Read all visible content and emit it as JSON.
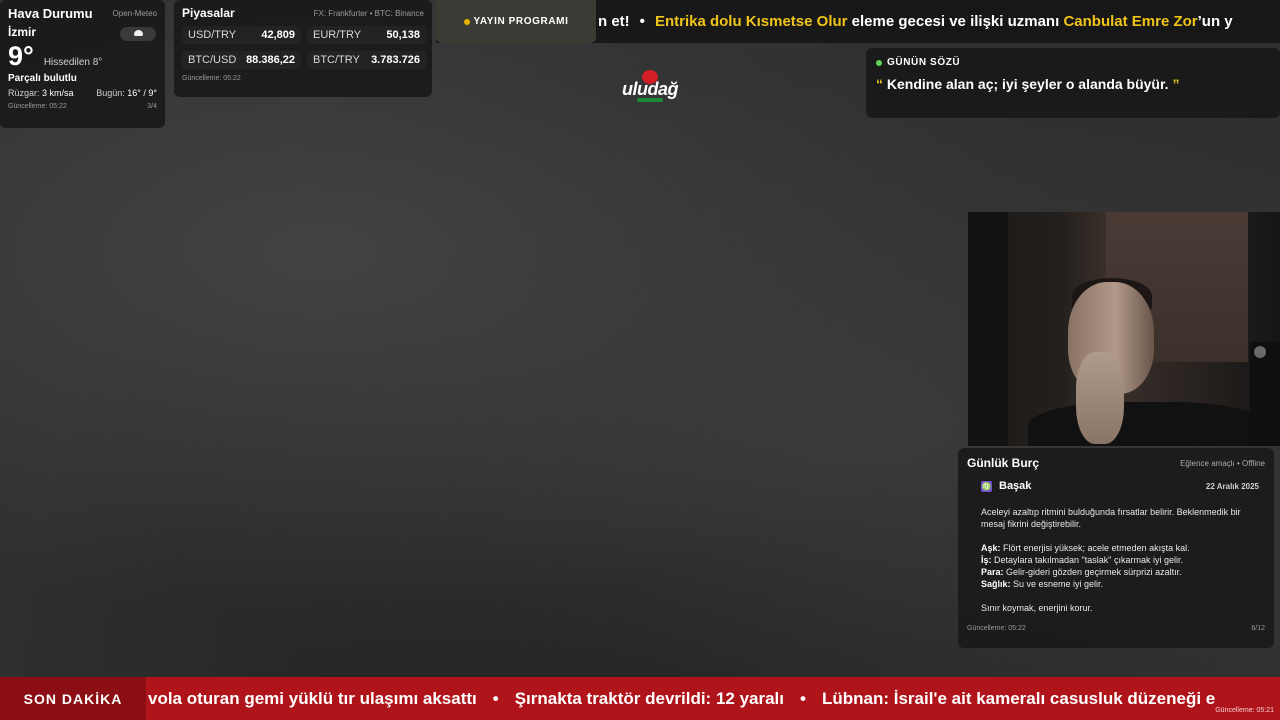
{
  "weather": {
    "title": "Hava Durumu",
    "source": "Open-Meteo",
    "city": "İzmir",
    "temperature": "9°",
    "feels_like": "Hissedilen 8°",
    "condition": "Parçalı bulutlu",
    "wind_label": "Rüzgar:",
    "wind_value": "3 km/sa",
    "today_label": "Bugün:",
    "today_value": "16° / 9°",
    "updated": "Güncelleme: 05:22",
    "page": "3/4",
    "icon": "partly-cloudy-icon"
  },
  "markets": {
    "title": "Piyasalar",
    "source": "FX: Frankfurter • BTC: Binance",
    "items": [
      {
        "label": "USD/TRY",
        "value": "42,809"
      },
      {
        "label": "EUR/TRY",
        "value": "50,138"
      },
      {
        "label": "BTC/USD",
        "value": "88.386,22"
      },
      {
        "label": "BTC/TRY",
        "value": "3.783.726"
      }
    ],
    "updated": "Güncelleme: 05:22"
  },
  "top_ticker": {
    "schedule_label": "YAYIN PROGRAMI",
    "tail_text": "n et!",
    "headline": {
      "part1": "Entrika dolu Kısmetse Olur",
      "part2": " eleme gecesi ve ilişki uzmanı ",
      "part3": "Canbulat Emre Zor",
      "part4": "’un y"
    }
  },
  "logo": {
    "text": "uludağ"
  },
  "quote": {
    "title": "GÜNÜN SÖZÜ",
    "open_mark": "“",
    "text": " Kendine alan aç; iyi şeyler o alanda büyür. ",
    "close_mark": "”"
  },
  "horoscope": {
    "title": "Günlük Burç",
    "status": "Eğlence amaçlı • Offline",
    "sign_symbol": "♍",
    "sign": "Başak",
    "date": "22 Aralık 2025",
    "intro": "Aceleyi azaltıp ritmini bulduğunda fırsatlar belirir. Beklenmedik bir mesaj fikrini değiştirebilir.",
    "love_label": "Aşk:",
    "love": " Flört enerjisi yüksek; acele etmeden akışta kal.",
    "work_label": "İş:",
    "work": " Detaylara takılmadan \"taslak\" çıkarmak iyi gelir.",
    "money_label": "Para:",
    "money": " Gelir-gideri gözden geçirmek sürprizi azaltır.",
    "health_label": "Sağlık:",
    "health": " Su ve esneme iyi gelir.",
    "closing": "Sınır koymak, enerjini korur.",
    "updated": "Güncelleme: 05:22",
    "page": "6/12"
  },
  "breaking": {
    "label": "SON DAKİKA",
    "items": [
      "vola oturan gemi yüklü tır ulaşımı aksattı",
      "Şırnakta traktör devrildi: 12 yaralı",
      "Lübnan: İsrail'e ait kameralı casusluk düzeneği e"
    ],
    "separator": "•",
    "updated": "Güncelleme: 05:21"
  },
  "colors": {
    "accent_yellow": "#f0c419",
    "breaking_red": "#b0141b",
    "quote_dot_green": "#5bd35b"
  }
}
